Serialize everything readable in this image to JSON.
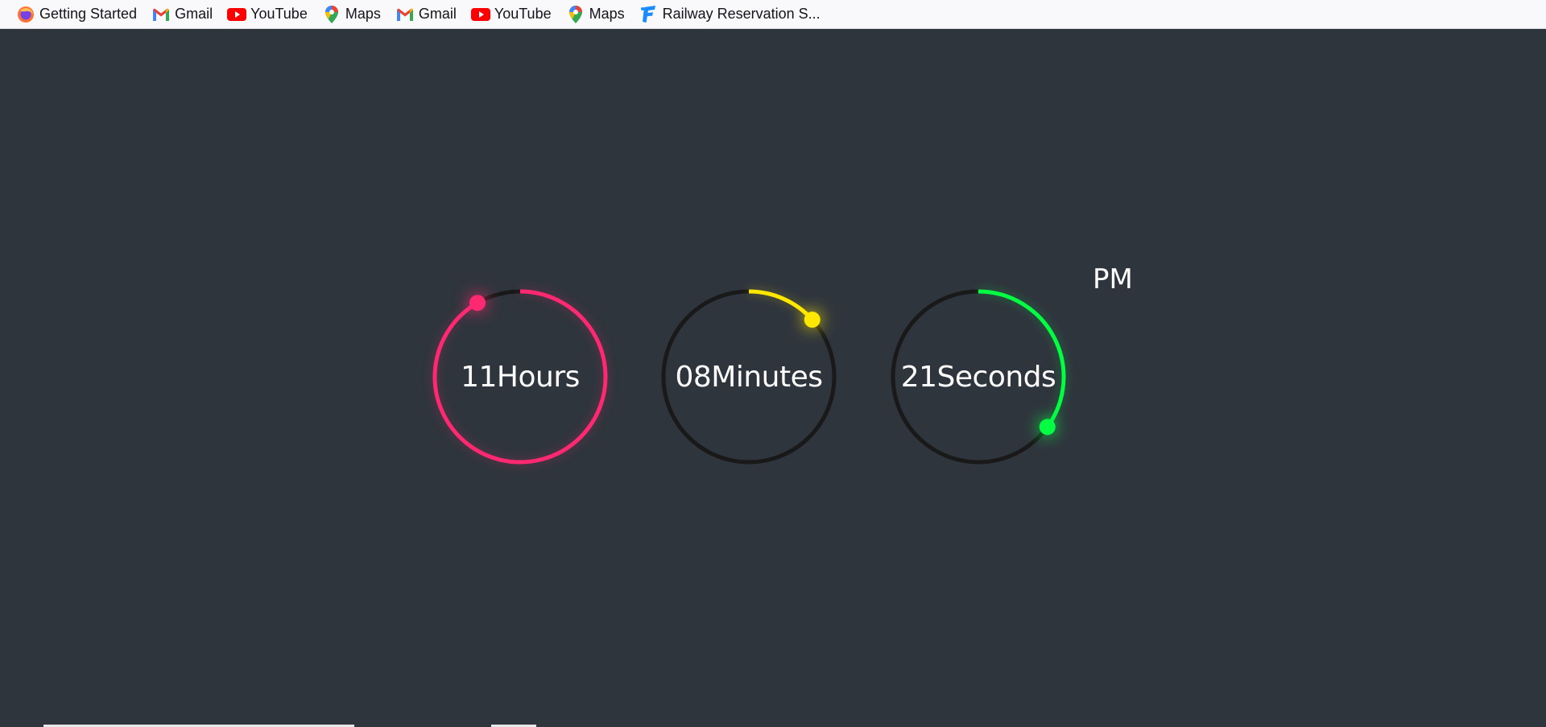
{
  "bookmarks": [
    {
      "label": "Getting Started",
      "icon": "firefox-icon"
    },
    {
      "label": "Gmail",
      "icon": "gmail-icon"
    },
    {
      "label": "YouTube",
      "icon": "youtube-icon"
    },
    {
      "label": "Maps",
      "icon": "maps-icon"
    },
    {
      "label": "Gmail",
      "icon": "gmail-icon"
    },
    {
      "label": "YouTube",
      "icon": "youtube-icon"
    },
    {
      "label": "Maps",
      "icon": "maps-icon"
    },
    {
      "label": "Railway Reservation S...",
      "icon": "railway-icon"
    }
  ],
  "clock": {
    "hours": {
      "value": "11",
      "unit": "Hours",
      "color": "#ff2972",
      "fraction": 0.9167
    },
    "minutes": {
      "value": "08",
      "unit": "Minutes",
      "color": "#fee800",
      "fraction": 0.1333
    },
    "seconds": {
      "value": "21",
      "unit": "Seconds",
      "color": "#04fc43",
      "fraction": 0.35
    },
    "ampm": "PM",
    "track_color": "#191919"
  }
}
